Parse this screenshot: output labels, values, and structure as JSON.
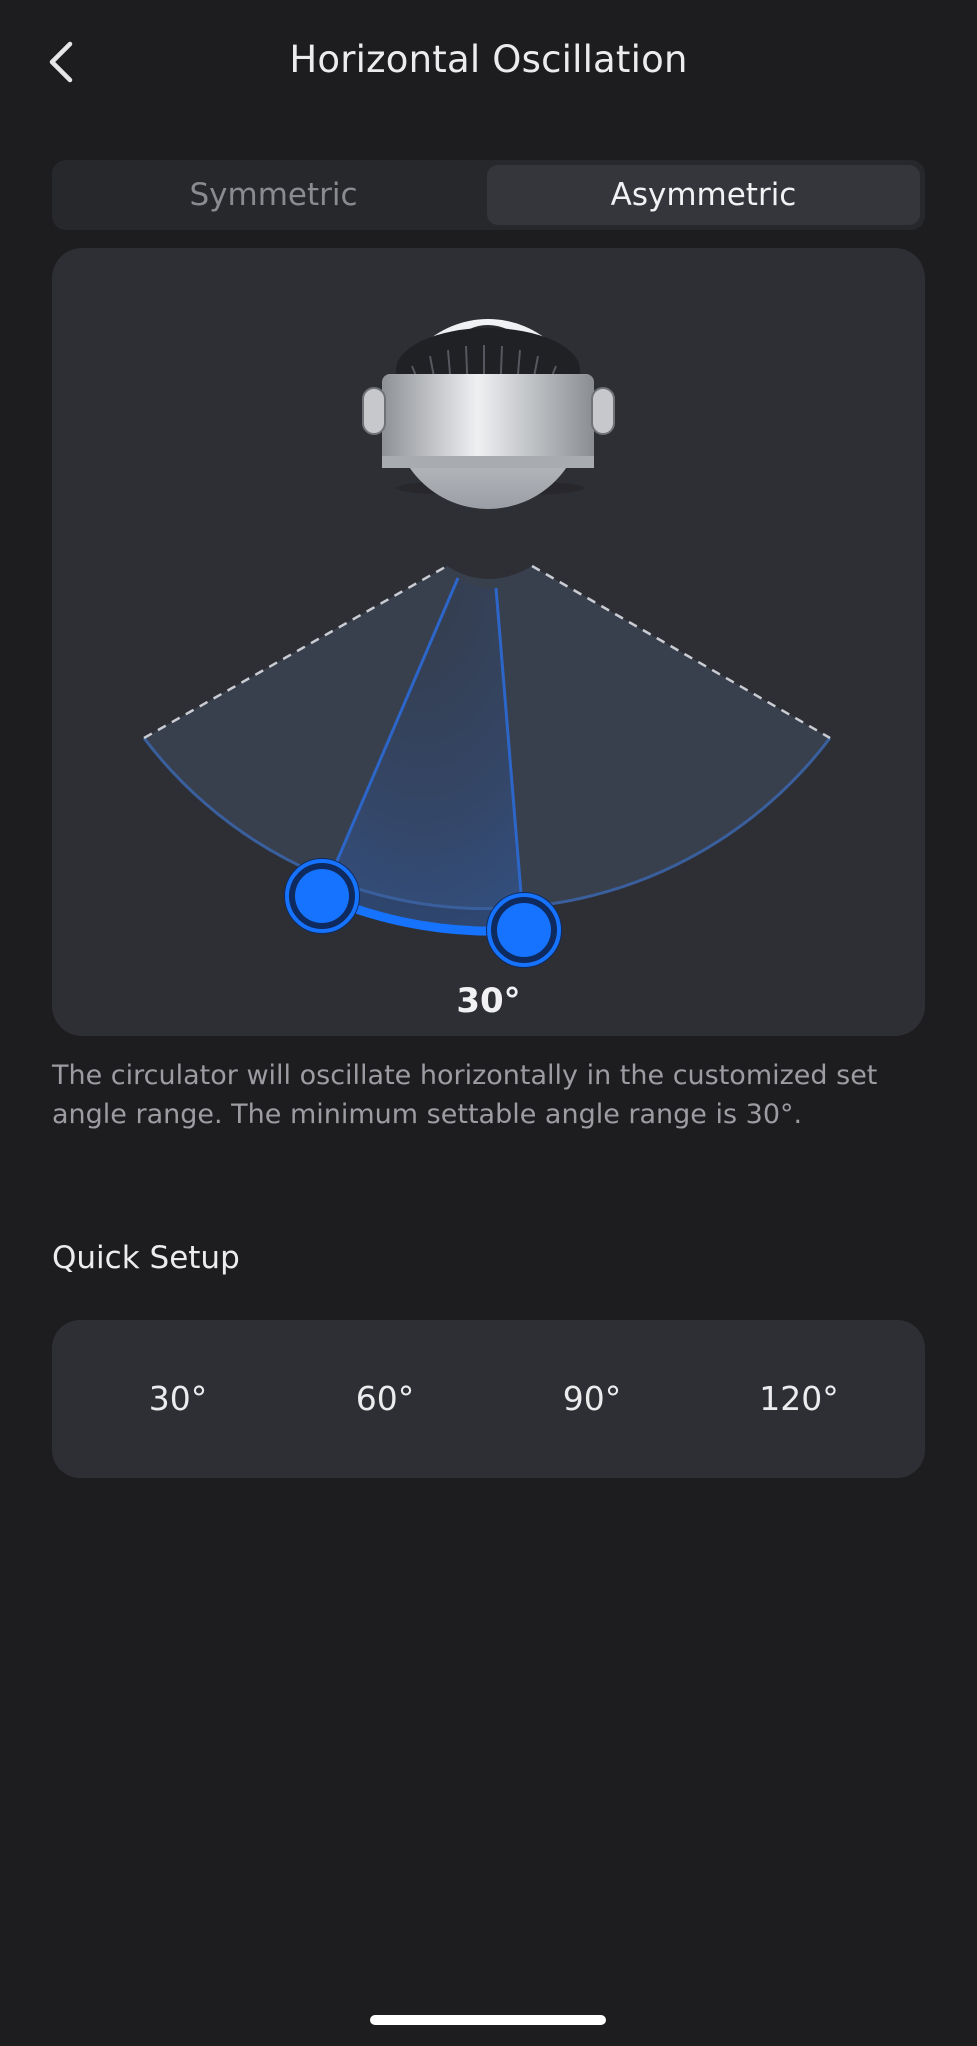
{
  "header": {
    "title": "Horizontal Oscillation",
    "back_icon": "chevron-left-icon"
  },
  "mode_tabs": [
    {
      "label": "Symmetric",
      "selected": false
    },
    {
      "label": "Asymmetric",
      "selected": true
    }
  ],
  "oscillation": {
    "angle_label": "30°",
    "angle_value": 30,
    "device_icon": "fan-circulator-icon"
  },
  "description": "The circulator will oscillate horizontally in the customized set angle range. The minimum settable angle range is 30°.",
  "quick_setup": {
    "title": "Quick Setup",
    "options": [
      "30°",
      "60°",
      "90°",
      "120°"
    ]
  },
  "colors": {
    "background": "#1d1d1f",
    "panel": "#2e2f34",
    "accent": "#1673ff"
  }
}
